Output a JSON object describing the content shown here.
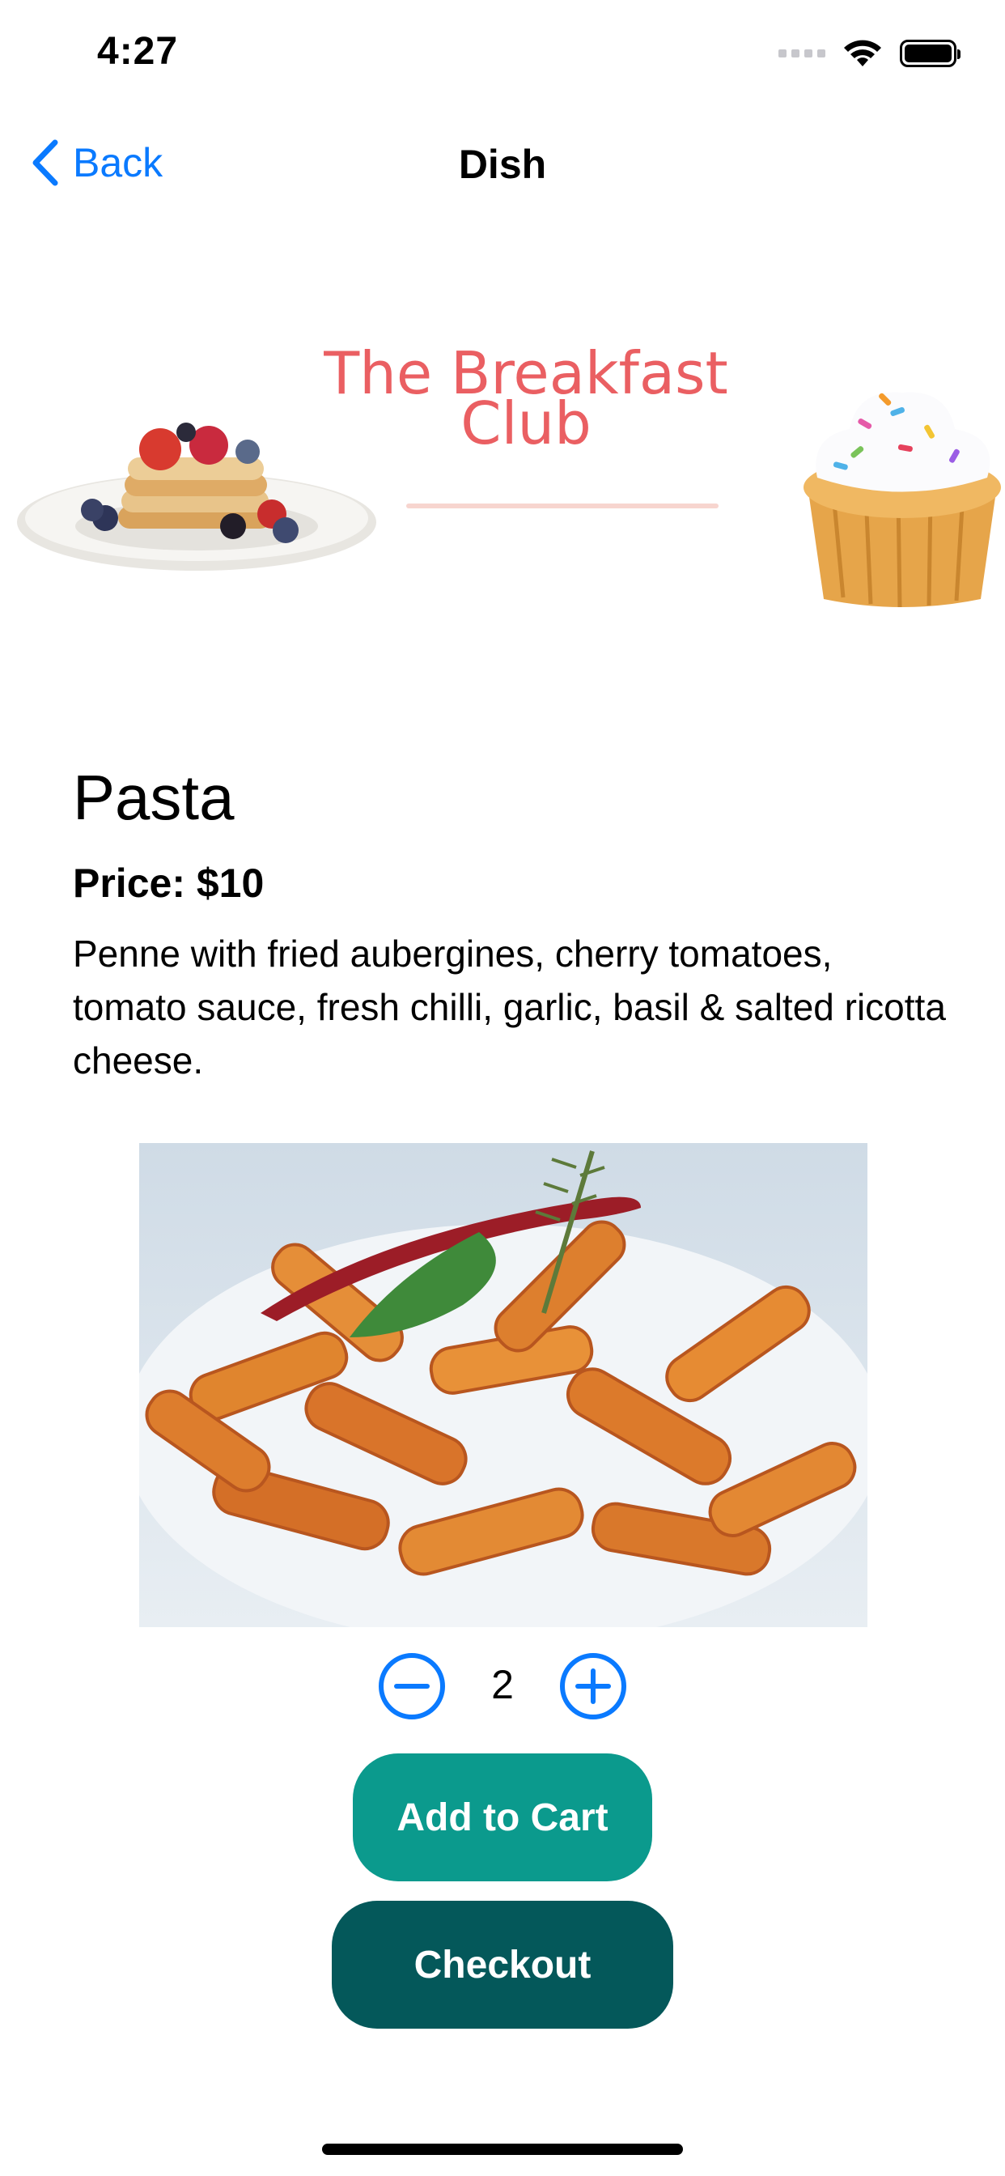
{
  "status_bar": {
    "time": "4:27"
  },
  "nav": {
    "back_label": "Back",
    "title": "Dish"
  },
  "banner": {
    "brand_line1": "The Breakfast",
    "brand_line2": "Club"
  },
  "dish": {
    "name": "Pasta",
    "price": "Price: $10",
    "description": "Penne with fried aubergines, cherry tomatoes, tomato sauce, fresh chilli, garlic, basil & salted ricotta cheese."
  },
  "stepper": {
    "quantity": "2"
  },
  "buttons": {
    "add_to_cart": "Add to Cart",
    "checkout": "Checkout"
  },
  "colors": {
    "accent_blue": "#0a7aff",
    "brand_red": "#ea5f62",
    "add_button": "#0b9a8d",
    "checkout_button": "#04585a"
  }
}
